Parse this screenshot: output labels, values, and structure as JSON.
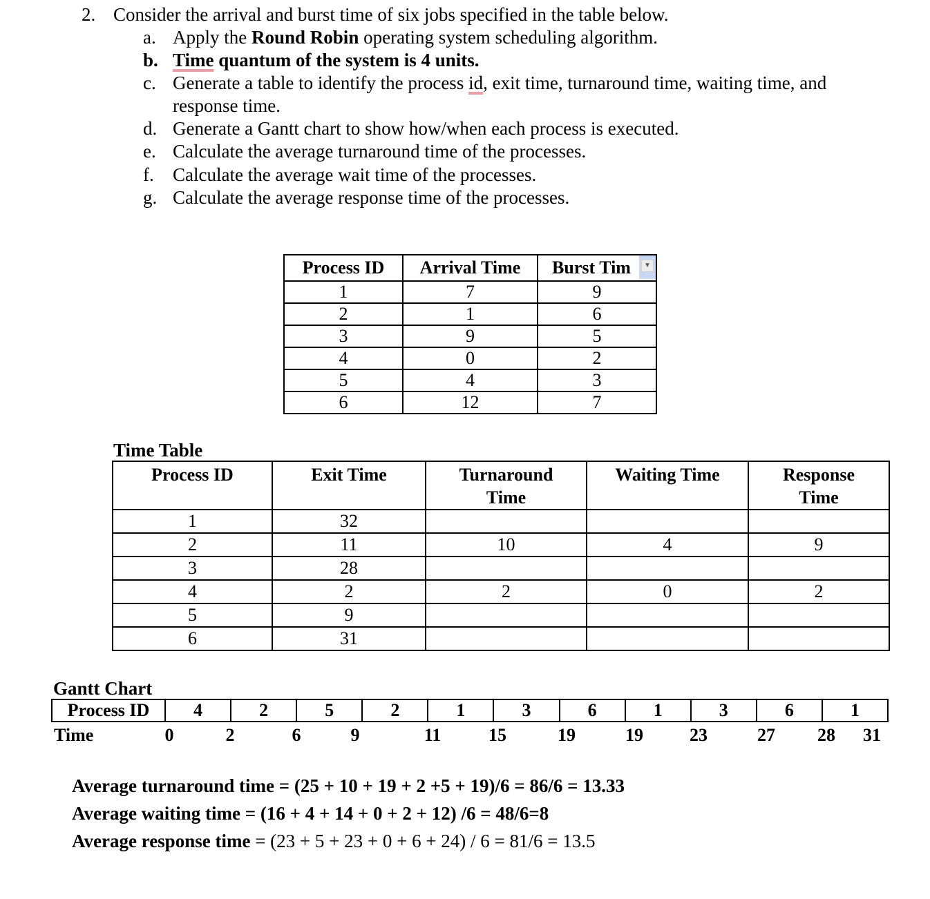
{
  "question": {
    "number": "2.",
    "text": "Consider the arrival and burst time of six jobs specified in the table below.",
    "items": [
      {
        "label": "a.",
        "pre": "Apply the ",
        "bold": "Round Robin",
        "post": " operating system scheduling algorithm."
      },
      {
        "label": "b.",
        "bold_underlined": "Time",
        "bold_rest": " quantum of the system is 4 units."
      },
      {
        "label": "c.",
        "line1_pre": "Generate a table to identify the process ",
        "line1_underlined": "id",
        "line1_post": ", exit time, turnaround time, waiting time, and",
        "line2": "response time."
      },
      {
        "label": "d.",
        "text": "Generate a Gantt chart to show how/when each process is executed."
      },
      {
        "label": "e.",
        "text": "Calculate the average turnaround time of the processes."
      },
      {
        "label": "f.",
        "text": "Calculate the average wait time of the processes."
      },
      {
        "label": "g.",
        "text": "Calculate the average response time of the processes."
      }
    ]
  },
  "input_table": {
    "headers": [
      "Process ID",
      "Arrival Time",
      "Burst Tim"
    ],
    "dropdown_icon": "dropdown-arrow-icon",
    "rows": [
      [
        "1",
        "7",
        "9"
      ],
      [
        "2",
        "1",
        "6"
      ],
      [
        "3",
        "9",
        "5"
      ],
      [
        "4",
        "0",
        "2"
      ],
      [
        "5",
        "4",
        "3"
      ],
      [
        "6",
        "12",
        "7"
      ]
    ]
  },
  "time_table": {
    "title": "Time Table",
    "headers": [
      {
        "line1": "Process ID",
        "line2": ""
      },
      {
        "line1": "Exit Time",
        "line2": ""
      },
      {
        "line1": "Turnaround",
        "line2": "Time"
      },
      {
        "line1": "Waiting Time",
        "line2": ""
      },
      {
        "line1": "Response",
        "line2": "Time"
      }
    ],
    "rows": [
      [
        "1",
        "32",
        "",
        "",
        ""
      ],
      [
        "2",
        "11",
        "10",
        "4",
        "9"
      ],
      [
        "3",
        "28",
        "",
        "",
        ""
      ],
      [
        "4",
        "2",
        "2",
        "0",
        "2"
      ],
      [
        "5",
        "9",
        "",
        "",
        ""
      ],
      [
        "6",
        "31",
        "",
        "",
        ""
      ]
    ]
  },
  "gantt": {
    "title": "Gantt Chart",
    "row_label": "Process ID",
    "time_label": "Time",
    "processes": [
      "4",
      "2",
      "5",
      "2",
      "1",
      "3",
      "6",
      "1",
      "3",
      "6",
      "1"
    ],
    "times": [
      "0",
      "2",
      "6",
      "9",
      "11",
      "15",
      "19",
      "19",
      "23",
      "27",
      "28",
      "31"
    ]
  },
  "averages": {
    "turnaround": {
      "label": "Average turnaround time",
      "formula": " = (25 + 10 + 19 + 2 +5 + 19)/6 = 86/6 = 13.33"
    },
    "waiting": {
      "label": "Average waiting time",
      "formula": " = (16 + 4 + 14 + 0 + 2 + 12) /6 = 48/6=8"
    },
    "response": {
      "label": "Average response time",
      "formula": " = (23 + 5 + 23 + 0 + 6 + 24) / 6 = 81/6 = 13.5"
    }
  }
}
